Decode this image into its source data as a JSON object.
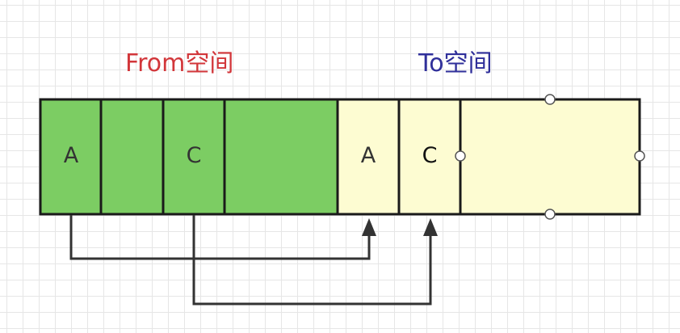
{
  "labels": {
    "from_space": "From空间",
    "to_space": "To空间"
  },
  "from_cells": [
    "A",
    "",
    "C",
    ""
  ],
  "to_cells": [
    "A",
    "C",
    ""
  ],
  "colors": {
    "from_label": "#d2363a",
    "to_label": "#2f2f9a",
    "from_fill": "#7ccd63",
    "to_fill": "#fdfcd2",
    "border": "#1a1a1a",
    "arrow": "#333333"
  }
}
